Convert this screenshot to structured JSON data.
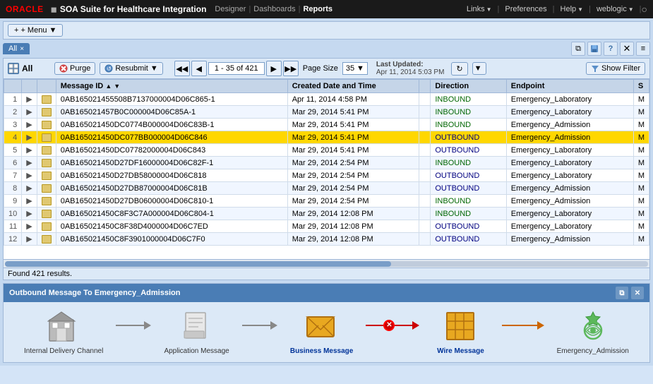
{
  "topnav": {
    "oracle_text": "ORACLE",
    "app_title": "SOA Suite for Healthcare Integration",
    "designer_label": "Designer",
    "dashboards_label": "Dashboards",
    "reports_label": "Reports",
    "links_label": "Links",
    "preferences_label": "Preferences",
    "help_label": "Help",
    "user_label": "weblogic",
    "window_icon": "○"
  },
  "menubar": {
    "menu_label": "+ Menu"
  },
  "tabs": {
    "all_tab_label": "All",
    "close_symbol": "×"
  },
  "tab_icons": {
    "restore": "⧉",
    "save": "💾",
    "help": "?",
    "close": "✕",
    "menu": "≡"
  },
  "grid": {
    "title": "All",
    "purge_label": "Purge",
    "resubmit_label": "Resubmit",
    "resubmit_arrow": "▼",
    "nav_first": "◀◀",
    "nav_prev": "◀",
    "page_info": "1 - 35 of 421",
    "nav_next": "▶",
    "nav_last": "▶▶",
    "page_size_label": "Page Size",
    "page_size_value": "35",
    "last_updated_label": "Last Updated:",
    "last_updated_value": "Apr 11, 2014 5:03 PM",
    "show_filter_label": "Show Filter",
    "funnel_icon": "⊿",
    "refresh_icon": "↻"
  },
  "table": {
    "columns": [
      "",
      "",
      "",
      "Message ID",
      "Created Date and Time",
      "",
      "Direction",
      "Endpoint",
      "S"
    ],
    "rows": [
      {
        "num": "1",
        "expand": "▶",
        "mid": "0AB165021455508B7137000004D06C865-1",
        "date": "Apr 11, 2014 4:58 PM",
        "dir": "INBOUND",
        "ep": "Emergency_Laboratory",
        "s": "M"
      },
      {
        "num": "2",
        "expand": "▶",
        "mid": "0AB165021457B0C000004D06C85A-1",
        "date": "Mar 29, 2014 5:41 PM",
        "dir": "INBOUND",
        "ep": "Emergency_Laboratory",
        "s": "M"
      },
      {
        "num": "3",
        "expand": "▶",
        "mid": "0AB165021450DC0774B000004D06C83B-1",
        "date": "Mar 29, 2014 5:41 PM",
        "dir": "INBOUND",
        "ep": "Emergency_Admission",
        "s": "M"
      },
      {
        "num": "4",
        "expand": "▶",
        "mid": "0AB165021450DC077BB000004D06C846",
        "date": "Mar 29, 2014 5:41 PM",
        "dir": "OUTBOUND",
        "ep": "Emergency_Admission",
        "s": "M",
        "highlight": true
      },
      {
        "num": "5",
        "expand": "▶",
        "mid": "0AB165021450DC07782000004D06C843",
        "date": "Mar 29, 2014 5:41 PM",
        "dir": "OUTBOUND",
        "ep": "Emergency_Laboratory",
        "s": "M"
      },
      {
        "num": "6",
        "expand": "▶",
        "mid": "0AB165021450D27DF16000004D06C82F-1",
        "date": "Mar 29, 2014 2:54 PM",
        "dir": "INBOUND",
        "ep": "Emergency_Laboratory",
        "s": "M"
      },
      {
        "num": "7",
        "expand": "▶",
        "mid": "0AB165021450D27DB58000004D06C818",
        "date": "Mar 29, 2014 2:54 PM",
        "dir": "OUTBOUND",
        "ep": "Emergency_Laboratory",
        "s": "M"
      },
      {
        "num": "8",
        "expand": "▶",
        "mid": "0AB165021450D27DB87000004D06C81B",
        "date": "Mar 29, 2014 2:54 PM",
        "dir": "OUTBOUND",
        "ep": "Emergency_Admission",
        "s": "M"
      },
      {
        "num": "9",
        "expand": "▶",
        "mid": "0AB165021450D27DB06000004D06C810-1",
        "date": "Mar 29, 2014 2:54 PM",
        "dir": "INBOUND",
        "ep": "Emergency_Admission",
        "s": "M"
      },
      {
        "num": "10",
        "expand": "▶",
        "mid": "0AB165021450C8F3C7A000004D06C804-1",
        "date": "Mar 29, 2014 12:08 PM",
        "dir": "INBOUND",
        "ep": "Emergency_Laboratory",
        "s": "M"
      },
      {
        "num": "11",
        "expand": "▶",
        "mid": "0AB165021450C8F38D4000004D06C7ED",
        "date": "Mar 29, 2014 12:08 PM",
        "dir": "OUTBOUND",
        "ep": "Emergency_Laboratory",
        "s": "M"
      },
      {
        "num": "12",
        "expand": "▶",
        "mid": "0AB165021450C8F3901000004D06C7F0",
        "date": "Mar 29, 2014 12:08 PM",
        "dir": "OUTBOUND",
        "ep": "Emergency_Admission",
        "s": "M"
      }
    ],
    "status_text": "Found 421 results."
  },
  "bottom_panel": {
    "title": "Outbound Message To Emergency_Admission",
    "restore_icon": "⧉",
    "close_icon": "✕",
    "flow": {
      "nodes": [
        {
          "label": "Internal Delivery Channel",
          "icon_type": "building",
          "active": false
        },
        {
          "label": "Application Message",
          "icon_type": "doc",
          "active": false
        },
        {
          "label": "Business Message",
          "icon_type": "envelope_open",
          "active": true
        },
        {
          "label": "Wire Message",
          "icon_type": "grid",
          "active": true
        },
        {
          "label": "Emergency_Admission",
          "icon_type": "gear",
          "active": false
        }
      ],
      "connectors": [
        "line",
        "line",
        "line-red",
        "line"
      ],
      "error_dot": "✕"
    }
  }
}
